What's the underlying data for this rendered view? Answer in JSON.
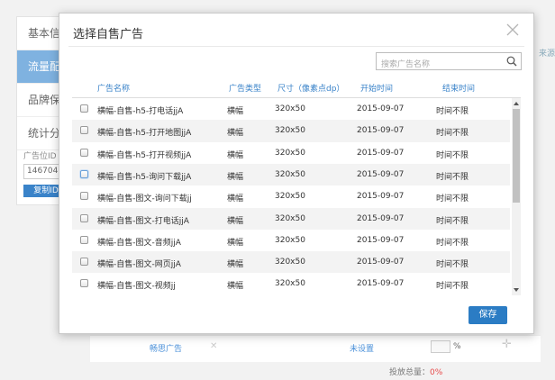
{
  "background": {
    "nav": [
      "基本信",
      "流量配",
      "品牌保",
      "统计分"
    ],
    "id_label": "广告位ID",
    "id_value": "1467047",
    "copy_label": "复制ID",
    "row_label": "畅思广告",
    "row_status": "未设置",
    "row_pct": "%",
    "total_label": "投放总量：",
    "total_value": "0%",
    "right_link": "来源"
  },
  "modal": {
    "title": "选择自售广告",
    "search_placeholder": "搜索广告名称",
    "headers": {
      "name": "广告名称",
      "type": "广告类型",
      "size": "尺寸（像素点dp）",
      "start": "开始时间",
      "end": "结束时间"
    },
    "rows": [
      {
        "name": "横幅-自售-h5-打电话jjA",
        "type": "横幅",
        "size": "320x50",
        "start": "2015-09-07",
        "end": "时间不限"
      },
      {
        "name": "横幅-自售-h5-打开地图jjA",
        "type": "横幅",
        "size": "320x50",
        "start": "2015-09-07",
        "end": "时间不限"
      },
      {
        "name": "横幅-自售-h5-打开视频jjA",
        "type": "横幅",
        "size": "320x50",
        "start": "2015-09-07",
        "end": "时间不限"
      },
      {
        "name": "横幅-自售-h5-询问下载jjA",
        "type": "横幅",
        "size": "320x50",
        "start": "2015-09-07",
        "end": "时间不限"
      },
      {
        "name": "横幅-自售-图文-询问下载jj",
        "type": "横幅",
        "size": "320x50",
        "start": "2015-09-07",
        "end": "时间不限"
      },
      {
        "name": "横幅-自售-图文-打电话jjA",
        "type": "横幅",
        "size": "320x50",
        "start": "2015-09-07",
        "end": "时间不限"
      },
      {
        "name": "横幅-自售-图文-音频jjA",
        "type": "横幅",
        "size": "320x50",
        "start": "2015-09-07",
        "end": "时间不限"
      },
      {
        "name": "横幅-自售-图文-网页jjA",
        "type": "横幅",
        "size": "320x50",
        "start": "2015-09-07",
        "end": "时间不限"
      },
      {
        "name": "横幅-自售-图文-视频jj",
        "type": "横幅",
        "size": "320x50",
        "start": "2015-09-07",
        "end": "时间不限"
      }
    ],
    "save_label": "保存"
  },
  "colors": {
    "accent": "#2b7cc4",
    "header_text": "#3a83c9",
    "danger": "#e84a4a"
  }
}
